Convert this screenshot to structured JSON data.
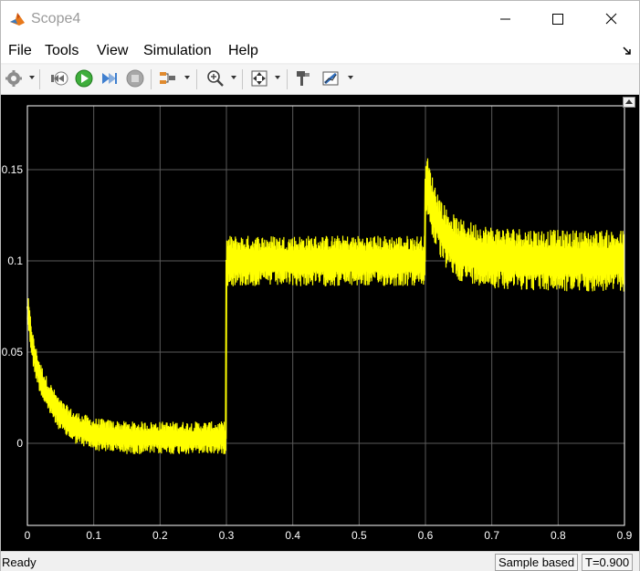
{
  "window": {
    "title": "Scope4"
  },
  "menu": [
    "File",
    "Tools",
    "View",
    "Simulation",
    "Help"
  ],
  "toolbar": {
    "icons": [
      "settings-icon",
      "step-back-icon",
      "run-icon",
      "step-forward-icon",
      "stop-icon",
      "highlight-icon",
      "zoom-in-icon",
      "autoscale-icon",
      "style-icon",
      "measurements-icon"
    ]
  },
  "status": {
    "text": "Ready",
    "mode": "Sample based",
    "time": "T=0.900"
  },
  "colors": {
    "plot_bg": "#000000",
    "trace": "#ffff00",
    "axis": "#ffffff",
    "grid": "#5a5a5a"
  },
  "chart_data": {
    "type": "line",
    "title": "",
    "xlabel": "",
    "ylabel": "",
    "xlim": [
      0,
      0.9
    ],
    "ylim": [
      -0.045,
      0.185
    ],
    "xticks": [
      0,
      0.1,
      0.2,
      0.3,
      0.4,
      0.5,
      0.6,
      0.7,
      0.8,
      0.9
    ],
    "xtick_labels": [
      "0",
      "0.1",
      "0.2",
      "0.3",
      "0.4",
      "0.5",
      "0.6",
      "0.7",
      "0.8",
      "0.9"
    ],
    "yticks": [
      0,
      0.05,
      0.1,
      0.15
    ],
    "ytick_labels": [
      "0",
      "0.05",
      "0.1",
      "0.15"
    ],
    "grid": true,
    "series": [
      {
        "x": [
          0,
          0.005,
          0.01,
          0.02,
          0.03,
          0.05,
          0.07,
          0.1,
          0.15,
          0.2,
          0.25,
          0.299,
          0.3,
          0.35,
          0.4,
          0.45,
          0.5,
          0.55,
          0.599,
          0.6,
          0.61,
          0.62,
          0.63,
          0.65,
          0.7,
          0.75,
          0.8,
          0.85,
          0.9
        ],
        "y": [
          0.075,
          0.06,
          0.048,
          0.035,
          0.027,
          0.015,
          0.009,
          0.005,
          0.003,
          0.003,
          0.003,
          0.003,
          0.1,
          0.1,
          0.1,
          0.1,
          0.1,
          0.1,
          0.1,
          0.145,
          0.13,
          0.12,
          0.113,
          0.106,
          0.102,
          0.101,
          0.1,
          0.1,
          0.1
        ]
      }
    ]
  }
}
